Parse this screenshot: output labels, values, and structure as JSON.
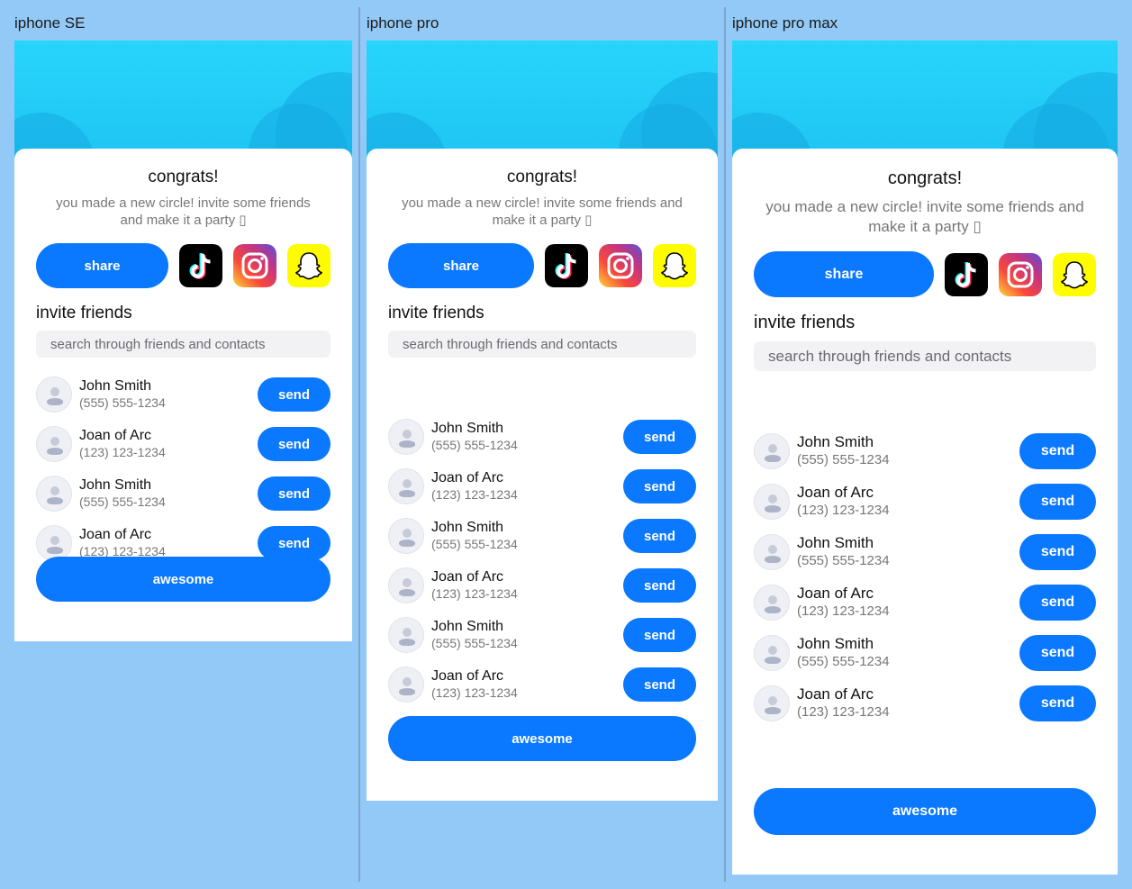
{
  "frames": [
    {
      "label": "iphone SE"
    },
    {
      "label": "iphone pro"
    },
    {
      "label": "iphone pro max"
    }
  ],
  "card": {
    "title": "congrats!",
    "subtitle_line1_se": "you made a new circle! invite some friends",
    "subtitle_line2_se": "and make it a party ▯",
    "subtitle_line1": "you made a new circle! invite some friends and",
    "subtitle_line2": "make it a party ▯",
    "share_label": "share",
    "social_icons": [
      "tiktok-icon",
      "instagram-icon",
      "snapchat-icon"
    ],
    "invite_title": "invite friends",
    "search_placeholder": "search through friends and contacts",
    "send_label": "send",
    "awesome_label": "awesome"
  },
  "contacts": [
    {
      "name": "John Smith",
      "phone": "(555) 555-1234"
    },
    {
      "name": "Joan of Arc",
      "phone": "(123) 123-1234"
    },
    {
      "name": "John Smith",
      "phone": "(555) 555-1234"
    },
    {
      "name": "Joan of Arc",
      "phone": "(123) 123-1234"
    },
    {
      "name": "John Smith",
      "phone": "(555) 555-1234"
    },
    {
      "name": "Joan of Arc",
      "phone": "(123) 123-1234"
    }
  ],
  "colors": {
    "background": "#93c9f6",
    "hero": "#27d5fb",
    "accent": "#0a78ff",
    "card": "#ffffff"
  }
}
